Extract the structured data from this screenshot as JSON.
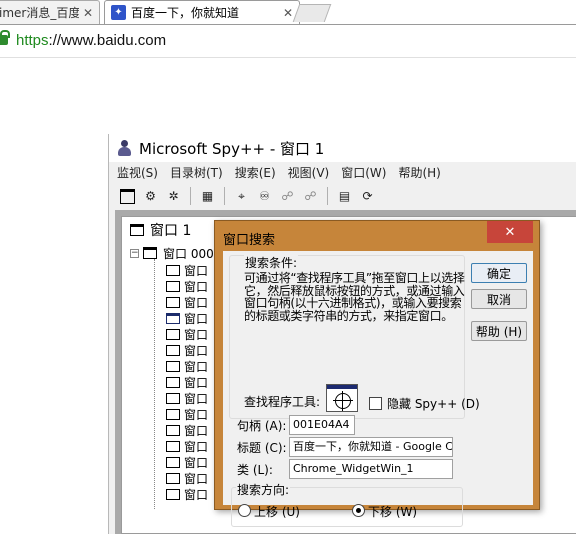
{
  "browser": {
    "tabs": [
      {
        "label": "imer消息_百度",
        "active": false
      },
      {
        "label": "百度一下，你就知道",
        "active": true
      }
    ],
    "close_glyph": "✕",
    "url_scheme": "https",
    "url_rest": "://www.baidu.com"
  },
  "spy": {
    "title": "Microsoft Spy++ - 窗口 1",
    "menu": [
      "监视(S)",
      "目录树(T)",
      "搜索(E)",
      "视图(V)",
      "窗口(W)",
      "帮助(H)"
    ],
    "child_title": "窗口 1",
    "tree_root": "窗口 000",
    "tree_item_label": "窗口",
    "tree_items_count_shown": 15
  },
  "dialog": {
    "title": "窗口搜索",
    "close_glyph": "✕",
    "group_label": "搜索条件:",
    "description": "可通过将“查找程序工具”拖至窗口上以选择它，然后释放鼠标按钮的方式，或通过输入窗口句柄(以十六进制格式)，或输入要搜索的标题或类字符串的方式，来指定窗口。",
    "finder_label": "查找程序工具:",
    "hide_label": "隐藏 Spy++ (D)",
    "hide_checked": false,
    "handle_label": "句柄 (A):",
    "handle_value": "001E04A4",
    "caption_label": "标题 (C):",
    "caption_value": "百度一下，你就知道 - Google C",
    "class_label": "类 (L):",
    "class_value": "Chrome_WidgetWin_1",
    "buttons": {
      "ok": "确定",
      "cancel": "取消",
      "help": "帮助 (H)"
    },
    "direction_label": "搜索方向:",
    "up_label": "上移 (U)",
    "down_label": "下移 (W)",
    "direction_selected": "down",
    "colors": {
      "frame": "#c6853a",
      "close": "#c7453a"
    }
  }
}
